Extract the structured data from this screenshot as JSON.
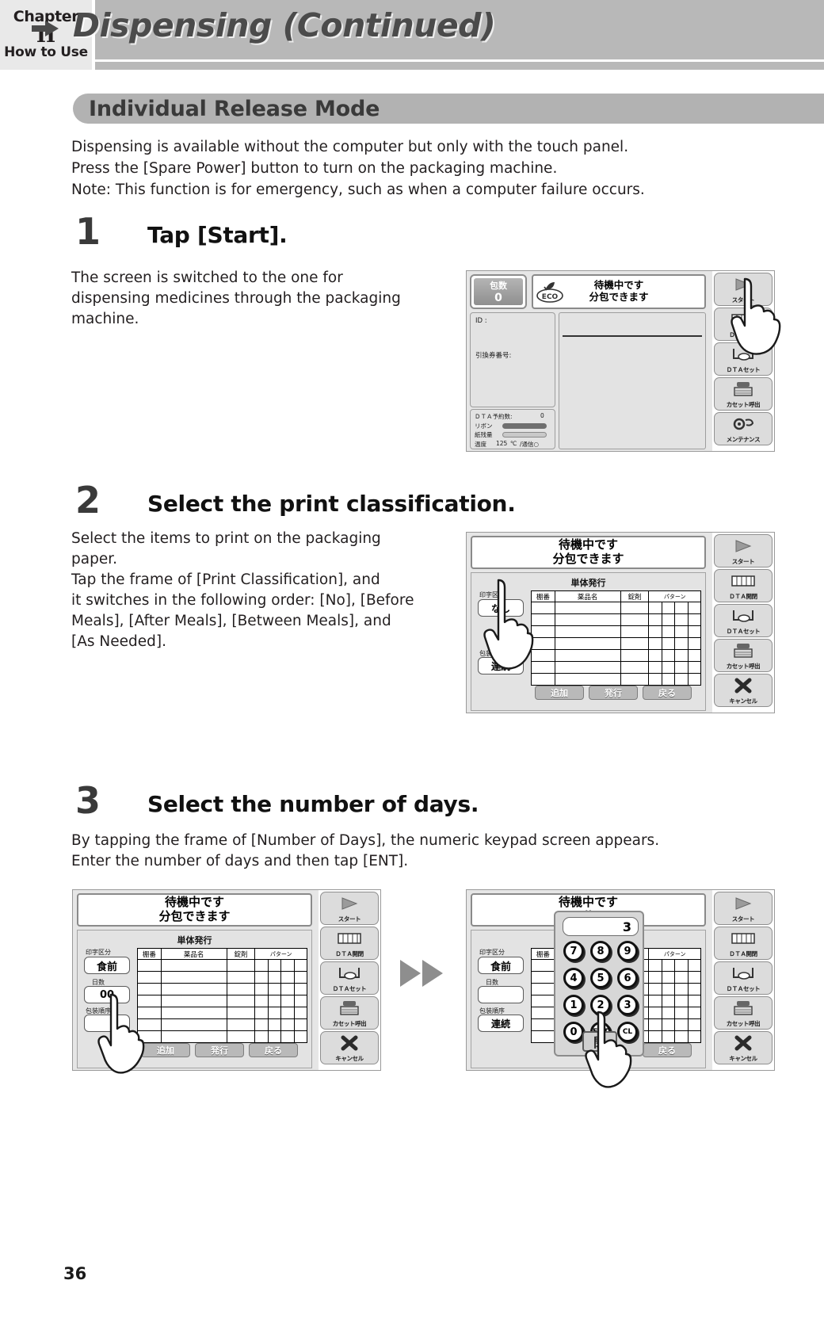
{
  "header": {
    "chapter_word": "Chapter",
    "chapter_num": "II",
    "chapter_sub": "How to Use",
    "title": "Dispensing (Continued)",
    "arrow_icon": "right-arrow-icon"
  },
  "section": {
    "title": "Individual Release Mode"
  },
  "intro": {
    "line1": "Dispensing is available without the computer but only with the touch panel.",
    "line2": "Press the [Spare Power] button to turn on the packaging machine.",
    "line3": "Note: This function is for emergency, such as when a computer failure occurs."
  },
  "steps": [
    {
      "number": "1",
      "title": "Tap [Start].",
      "body_line1": "The screen is switched to the one for",
      "body_line2": "dispensing medicines through the packaging",
      "body_line3": "machine."
    },
    {
      "number": "2",
      "title": "Select the print classification.",
      "body_line1": "Select the items to print on the packaging",
      "body_line2": "paper.",
      "body_line3": "Tap the frame of [Print Classification], and",
      "body_line4": "it switches in the following order: [No], [Before",
      "body_line5": "Meals], [After Meals], [Between Meals], and",
      "body_line6": "[As Needed]."
    },
    {
      "number": "3",
      "title": "Select the number of days.",
      "body_line1": "By tapping the frame of [Number of Days], the numeric keypad screen appears.",
      "body_line2": "Enter the number of days and then tap [ENT]."
    }
  ],
  "screen1": {
    "count_label": "包数",
    "count_value": "0",
    "eco_label": "ECO",
    "status_line1": "待機中です",
    "status_line2": "分包できます",
    "id_label": "ID :",
    "ticket_label": "引換券番号:",
    "dta_reserve_label": "ＤＴＡ予約数:",
    "dta_reserve_value": "0",
    "ribbon_label": "リボン",
    "paper_label": "紙残量",
    "temp_label": "温度",
    "temp_value": "125",
    "temp_unit": "℃",
    "comm_label": "/通信○",
    "side_buttons": [
      {
        "label": "スタート",
        "icon": "play-triangle-icon"
      },
      {
        "label": "ＤＴＡ開閉",
        "icon": "dta-open-close-icon"
      },
      {
        "label": "ＤＴＡセット",
        "icon": "dta-set-icon"
      },
      {
        "label": "カセット呼出",
        "icon": "cassette-call-icon"
      },
      {
        "label": "メンテナンス",
        "icon": "maintenance-gear-icon"
      }
    ]
  },
  "screen2": {
    "status_line1": "待機中です",
    "status_line2": "分包できます",
    "form_title": "単体発行",
    "print_class_label": "印字区分",
    "print_class_value": "なし",
    "pack_order_label": "包装順序",
    "pack_order_value": "連続",
    "table_headers": [
      "棚番",
      "薬品名",
      "錠剤",
      "パターン"
    ],
    "buttons": [
      "追加",
      "発行",
      "戻る"
    ],
    "side_buttons": [
      {
        "label": "スタート",
        "icon": "play-triangle-icon"
      },
      {
        "label": "ＤＴＡ開閉",
        "icon": "dta-open-close-icon"
      },
      {
        "label": "ＤＴＡセット",
        "icon": "dta-set-icon"
      },
      {
        "label": "カセット呼出",
        "icon": "cassette-call-icon"
      },
      {
        "label": "キャンセル",
        "icon": "cancel-cross-icon"
      }
    ]
  },
  "screen3a": {
    "status_line1": "待機中です",
    "status_line2": "分包できます",
    "form_title": "単体発行",
    "print_class_label": "印字区分",
    "print_class_value": "食前",
    "days_label": "日数",
    "days_value": "00",
    "pack_order_label": "包装順序",
    "table_headers": [
      "棚番",
      "薬品名",
      "錠剤",
      "パターン"
    ],
    "buttons": [
      "追加",
      "発行",
      "戻る"
    ],
    "side_buttons": [
      {
        "label": "スタート",
        "icon": "play-triangle-icon"
      },
      {
        "label": "ＤＴＡ開閉",
        "icon": "dta-open-close-icon"
      },
      {
        "label": "ＤＴＡセット",
        "icon": "dta-set-icon"
      },
      {
        "label": "カセット呼出",
        "icon": "cassette-call-icon"
      },
      {
        "label": "キャンセル",
        "icon": "cancel-cross-icon"
      }
    ]
  },
  "screen3b": {
    "status_line1": "待機中です",
    "status_line2": "分",
    "print_class_label": "印字区分",
    "print_class_value": "食前",
    "days_label": "日数",
    "days_value": "",
    "pack_order_label": "包装順序",
    "pack_order_value": "連続",
    "table_header_first": "棚番",
    "table_header_pattern": "パターン",
    "back_button": "戻る",
    "keypad": {
      "display_value": "3",
      "keys": [
        "7",
        "8",
        "9",
        "4",
        "5",
        "6",
        "1",
        "2",
        "3",
        "0",
        "ENT",
        "CL"
      ],
      "close_label": "閉"
    },
    "side_buttons": [
      {
        "label": "スタート",
        "icon": "play-triangle-icon"
      },
      {
        "label": "ＤＴＡ開閉",
        "icon": "dta-open-close-icon"
      },
      {
        "label": "ＤＴＡセット",
        "icon": "dta-set-icon"
      },
      {
        "label": "カセット呼出",
        "icon": "cassette-call-icon"
      },
      {
        "label": "キャンセル",
        "icon": "cancel-cross-icon"
      }
    ]
  },
  "flow_arrow_icon": "double-right-arrow-icon",
  "page_number": "36"
}
